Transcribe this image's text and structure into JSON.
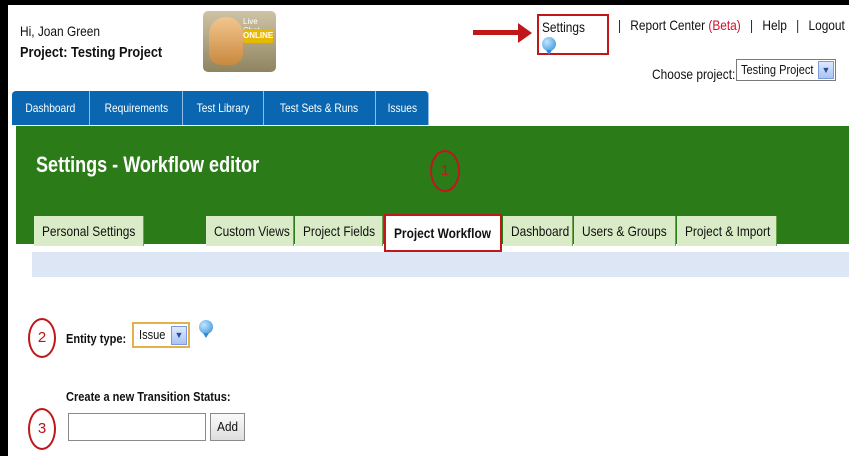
{
  "header": {
    "greeting": "Hi, Joan Green",
    "project_line": "Project: Testing Project",
    "live_chat": {
      "label": "Live Chat",
      "status": "ONLINE"
    }
  },
  "top_links": {
    "settings": "Settings",
    "report_center": "Report Center",
    "beta": "(Beta)",
    "help": "Help",
    "logout": "Logout",
    "separator": "|"
  },
  "project_chooser": {
    "label": "Choose project:",
    "selected": "Testing Project"
  },
  "main_nav": {
    "tabs": [
      {
        "label": "Dashboard"
      },
      {
        "label": "Requirements"
      },
      {
        "label": "Test Library"
      },
      {
        "label": "Test Sets & Runs"
      },
      {
        "label": "Issues"
      }
    ]
  },
  "settings_page": {
    "title": "Settings - Workflow editor",
    "tabs": [
      {
        "label": "Personal Settings"
      },
      {
        "label": "Custom Views"
      },
      {
        "label": "Project Fields"
      },
      {
        "label": "Project Workflow"
      },
      {
        "label": "Dashboard"
      },
      {
        "label": "Users & Groups"
      },
      {
        "label": "Project & Import"
      }
    ],
    "active_tab": "Project Workflow"
  },
  "annotations": {
    "step1": "1",
    "step2": "2",
    "step3": "3"
  },
  "form": {
    "entity_type_label": "Entity type:",
    "entity_type_value": "Issue",
    "create_transition_label": "Create a new Transition Status:",
    "create_transition_value": "",
    "add_button": "Add"
  },
  "colors": {
    "nav_blue": "#0a66b0",
    "settings_green": "#2b7c19",
    "annotation_red": "#c0171a",
    "beta_red": "#d0102a",
    "subtab_bg": "#d9ecc7",
    "info_blue": "#2e8ad8"
  },
  "icons": [
    "info-icon",
    "arrow-icon",
    "dropdown-arrow-icon",
    "live-chat-icon"
  ]
}
